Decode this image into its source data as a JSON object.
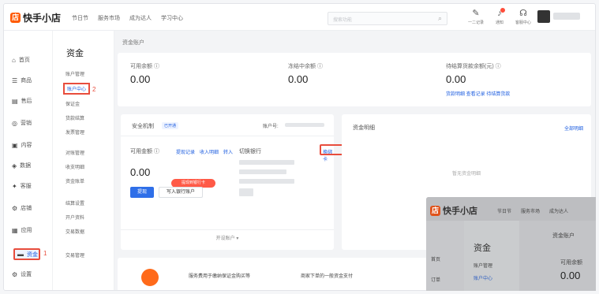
{
  "app": {
    "name": "快手小店"
  },
  "topbar": {
    "nav": [
      "节日节",
      "服务市场",
      "成为达人",
      "学习中心"
    ],
    "search_placeholder": "搜索功能",
    "icons": [
      {
        "name": "notebook-icon",
        "glyph": "✎",
        "label": "一二记录"
      },
      {
        "name": "bell-icon",
        "glyph": "♪",
        "label": "通知"
      },
      {
        "name": "headset-icon",
        "glyph": "☊",
        "label": "客服中心"
      }
    ]
  },
  "sidebar": {
    "items": [
      {
        "icon": "home-icon",
        "glyph": "⌂",
        "label": "首页"
      },
      {
        "icon": "goods-icon",
        "glyph": "☰",
        "label": "商品"
      },
      {
        "icon": "order-icon",
        "glyph": "▤",
        "label": "售后"
      },
      {
        "icon": "marketing-icon",
        "glyph": "◎",
        "label": "营销"
      },
      {
        "icon": "content-icon",
        "glyph": "▣",
        "label": "内容"
      },
      {
        "icon": "data-icon",
        "glyph": "◈",
        "label": "数据"
      },
      {
        "icon": "service-icon",
        "glyph": "✦",
        "label": "客服"
      },
      {
        "icon": "shop-icon",
        "glyph": "⚙",
        "label": "店铺"
      },
      {
        "icon": "app-icon",
        "glyph": "▦",
        "label": "应用"
      },
      {
        "icon": "wallet-icon",
        "glyph": "▬",
        "label": "资金"
      },
      {
        "icon": "settings-icon",
        "glyph": "⚙",
        "label": "设置"
      }
    ],
    "active_label": "资金"
  },
  "sub_sidebar": {
    "title": "资金",
    "items": [
      "账户管理",
      "账户中心",
      "保证金",
      "货款结算",
      "发票管理",
      "对账管理",
      "收支明细",
      "资金账单",
      "结算设置",
      "开户资料",
      "交易数据"
    ],
    "selected": "账户中心",
    "extra": "交易管理"
  },
  "annotations": {
    "step1": "1",
    "step2": "2",
    "step3": "3"
  },
  "main": {
    "breadcrumb": "资金账户",
    "metrics": [
      {
        "label": "可用余额 ⓘ",
        "value": "0.00"
      },
      {
        "label": "冻结中余额 ⓘ",
        "value": "0.00"
      },
      {
        "label": "待结算货款余额(元) ⓘ",
        "value": "0.00",
        "links": "货款明细 查看记录  待结算货款"
      }
    ],
    "account_card": {
      "tab": "安全机制",
      "tab_badge": "已开通",
      "account_label": "账户号:",
      "available_label": "可用金额 ⓘ",
      "links": [
        "提现记录",
        "收入明细",
        "转入",
        "对账明细"
      ],
      "amount": "0.00",
      "pill": "提现到银行卡",
      "btn_withdraw": "提现",
      "btn_bind": "写入银行账户",
      "bank_label": "切换银行",
      "change_link": "换绑卡",
      "footer": "开设账户 ▾"
    },
    "right_card": {
      "title": "资金明细",
      "link": "全部明细",
      "empty": "暂无资金明细"
    },
    "promo": [
      "服务费用于缴纳保证金购买等",
      "商家下单的一般资金支付"
    ]
  },
  "overlay": {
    "app_name": "快手小店",
    "nav": [
      "节日节",
      "服务市场",
      "成为达人"
    ],
    "crumb": "资金账户",
    "side": [
      "首页",
      "订单"
    ],
    "sub_title": "资金",
    "sub_items": [
      "账户管理",
      "账户中心"
    ],
    "metric_label": "可用余额",
    "metric_value": "0.00"
  }
}
